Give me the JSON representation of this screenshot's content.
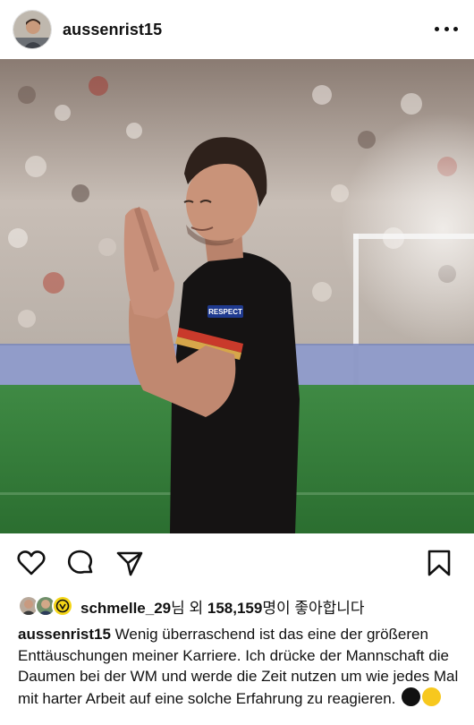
{
  "post": {
    "username": "aussenrist15",
    "avatar_icon": "profile-avatar",
    "more_icon": "more-horizontal-icon"
  },
  "photo": {
    "badge_text": "RESPECT",
    "colors": {
      "shirt": "#151313",
      "pitch": "#2f7a34",
      "stand": "#cfc7c0"
    }
  },
  "actions": {
    "icons": [
      "heart-icon",
      "comment-icon",
      "share-icon",
      "bookmark-icon"
    ]
  },
  "likes": {
    "first_liker": "schmelle_29",
    "suffix_1": "님 외 ",
    "count": "158,159",
    "suffix_2": "명이 좋아합니다"
  },
  "caption": {
    "username": "aussenrist15",
    "text": " Wenig überraschend ist das eine der größeren Enttäuschungen meiner Karriere. Ich drücke der Mannschaft die Daumen bei der WM und werde die Zeit nutzen um wie jedes Mal mit harter Arbeit auf eine solche Erfahrung zu reagieren.",
    "emojis": [
      "black-circle-emoji",
      "yellow-circle-emoji"
    ]
  }
}
